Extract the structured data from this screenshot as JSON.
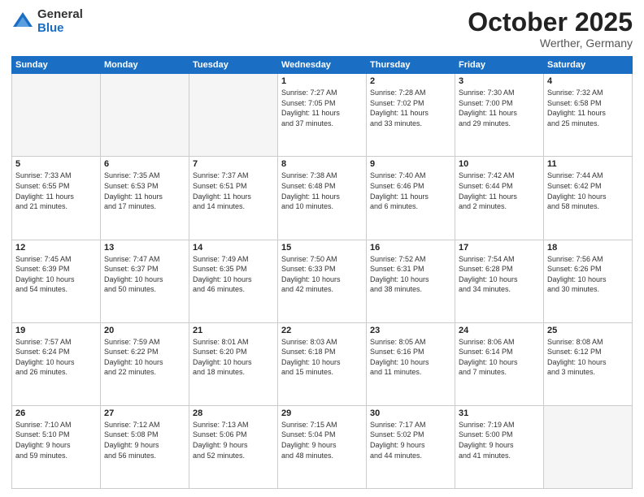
{
  "header": {
    "logo_general": "General",
    "logo_blue": "Blue",
    "month": "October 2025",
    "location": "Werther, Germany"
  },
  "days_of_week": [
    "Sunday",
    "Monday",
    "Tuesday",
    "Wednesday",
    "Thursday",
    "Friday",
    "Saturday"
  ],
  "weeks": [
    [
      {
        "day": "",
        "empty": true,
        "lines": []
      },
      {
        "day": "",
        "empty": true,
        "lines": []
      },
      {
        "day": "",
        "empty": true,
        "lines": []
      },
      {
        "day": "1",
        "empty": false,
        "lines": [
          "Sunrise: 7:27 AM",
          "Sunset: 7:05 PM",
          "Daylight: 11 hours",
          "and 37 minutes."
        ]
      },
      {
        "day": "2",
        "empty": false,
        "lines": [
          "Sunrise: 7:28 AM",
          "Sunset: 7:02 PM",
          "Daylight: 11 hours",
          "and 33 minutes."
        ]
      },
      {
        "day": "3",
        "empty": false,
        "lines": [
          "Sunrise: 7:30 AM",
          "Sunset: 7:00 PM",
          "Daylight: 11 hours",
          "and 29 minutes."
        ]
      },
      {
        "day": "4",
        "empty": false,
        "lines": [
          "Sunrise: 7:32 AM",
          "Sunset: 6:58 PM",
          "Daylight: 11 hours",
          "and 25 minutes."
        ]
      }
    ],
    [
      {
        "day": "5",
        "empty": false,
        "lines": [
          "Sunrise: 7:33 AM",
          "Sunset: 6:55 PM",
          "Daylight: 11 hours",
          "and 21 minutes."
        ]
      },
      {
        "day": "6",
        "empty": false,
        "lines": [
          "Sunrise: 7:35 AM",
          "Sunset: 6:53 PM",
          "Daylight: 11 hours",
          "and 17 minutes."
        ]
      },
      {
        "day": "7",
        "empty": false,
        "lines": [
          "Sunrise: 7:37 AM",
          "Sunset: 6:51 PM",
          "Daylight: 11 hours",
          "and 14 minutes."
        ]
      },
      {
        "day": "8",
        "empty": false,
        "lines": [
          "Sunrise: 7:38 AM",
          "Sunset: 6:48 PM",
          "Daylight: 11 hours",
          "and 10 minutes."
        ]
      },
      {
        "day": "9",
        "empty": false,
        "lines": [
          "Sunrise: 7:40 AM",
          "Sunset: 6:46 PM",
          "Daylight: 11 hours",
          "and 6 minutes."
        ]
      },
      {
        "day": "10",
        "empty": false,
        "lines": [
          "Sunrise: 7:42 AM",
          "Sunset: 6:44 PM",
          "Daylight: 11 hours",
          "and 2 minutes."
        ]
      },
      {
        "day": "11",
        "empty": false,
        "lines": [
          "Sunrise: 7:44 AM",
          "Sunset: 6:42 PM",
          "Daylight: 10 hours",
          "and 58 minutes."
        ]
      }
    ],
    [
      {
        "day": "12",
        "empty": false,
        "lines": [
          "Sunrise: 7:45 AM",
          "Sunset: 6:39 PM",
          "Daylight: 10 hours",
          "and 54 minutes."
        ]
      },
      {
        "day": "13",
        "empty": false,
        "lines": [
          "Sunrise: 7:47 AM",
          "Sunset: 6:37 PM",
          "Daylight: 10 hours",
          "and 50 minutes."
        ]
      },
      {
        "day": "14",
        "empty": false,
        "lines": [
          "Sunrise: 7:49 AM",
          "Sunset: 6:35 PM",
          "Daylight: 10 hours",
          "and 46 minutes."
        ]
      },
      {
        "day": "15",
        "empty": false,
        "lines": [
          "Sunrise: 7:50 AM",
          "Sunset: 6:33 PM",
          "Daylight: 10 hours",
          "and 42 minutes."
        ]
      },
      {
        "day": "16",
        "empty": false,
        "lines": [
          "Sunrise: 7:52 AM",
          "Sunset: 6:31 PM",
          "Daylight: 10 hours",
          "and 38 minutes."
        ]
      },
      {
        "day": "17",
        "empty": false,
        "lines": [
          "Sunrise: 7:54 AM",
          "Sunset: 6:28 PM",
          "Daylight: 10 hours",
          "and 34 minutes."
        ]
      },
      {
        "day": "18",
        "empty": false,
        "lines": [
          "Sunrise: 7:56 AM",
          "Sunset: 6:26 PM",
          "Daylight: 10 hours",
          "and 30 minutes."
        ]
      }
    ],
    [
      {
        "day": "19",
        "empty": false,
        "lines": [
          "Sunrise: 7:57 AM",
          "Sunset: 6:24 PM",
          "Daylight: 10 hours",
          "and 26 minutes."
        ]
      },
      {
        "day": "20",
        "empty": false,
        "lines": [
          "Sunrise: 7:59 AM",
          "Sunset: 6:22 PM",
          "Daylight: 10 hours",
          "and 22 minutes."
        ]
      },
      {
        "day": "21",
        "empty": false,
        "lines": [
          "Sunrise: 8:01 AM",
          "Sunset: 6:20 PM",
          "Daylight: 10 hours",
          "and 18 minutes."
        ]
      },
      {
        "day": "22",
        "empty": false,
        "lines": [
          "Sunrise: 8:03 AM",
          "Sunset: 6:18 PM",
          "Daylight: 10 hours",
          "and 15 minutes."
        ]
      },
      {
        "day": "23",
        "empty": false,
        "lines": [
          "Sunrise: 8:05 AM",
          "Sunset: 6:16 PM",
          "Daylight: 10 hours",
          "and 11 minutes."
        ]
      },
      {
        "day": "24",
        "empty": false,
        "lines": [
          "Sunrise: 8:06 AM",
          "Sunset: 6:14 PM",
          "Daylight: 10 hours",
          "and 7 minutes."
        ]
      },
      {
        "day": "25",
        "empty": false,
        "lines": [
          "Sunrise: 8:08 AM",
          "Sunset: 6:12 PM",
          "Daylight: 10 hours",
          "and 3 minutes."
        ]
      }
    ],
    [
      {
        "day": "26",
        "empty": false,
        "lines": [
          "Sunrise: 7:10 AM",
          "Sunset: 5:10 PM",
          "Daylight: 9 hours",
          "and 59 minutes."
        ]
      },
      {
        "day": "27",
        "empty": false,
        "lines": [
          "Sunrise: 7:12 AM",
          "Sunset: 5:08 PM",
          "Daylight: 9 hours",
          "and 56 minutes."
        ]
      },
      {
        "day": "28",
        "empty": false,
        "lines": [
          "Sunrise: 7:13 AM",
          "Sunset: 5:06 PM",
          "Daylight: 9 hours",
          "and 52 minutes."
        ]
      },
      {
        "day": "29",
        "empty": false,
        "lines": [
          "Sunrise: 7:15 AM",
          "Sunset: 5:04 PM",
          "Daylight: 9 hours",
          "and 48 minutes."
        ]
      },
      {
        "day": "30",
        "empty": false,
        "lines": [
          "Sunrise: 7:17 AM",
          "Sunset: 5:02 PM",
          "Daylight: 9 hours",
          "and 44 minutes."
        ]
      },
      {
        "day": "31",
        "empty": false,
        "lines": [
          "Sunrise: 7:19 AM",
          "Sunset: 5:00 PM",
          "Daylight: 9 hours",
          "and 41 minutes."
        ]
      },
      {
        "day": "",
        "empty": true,
        "lines": []
      }
    ]
  ]
}
